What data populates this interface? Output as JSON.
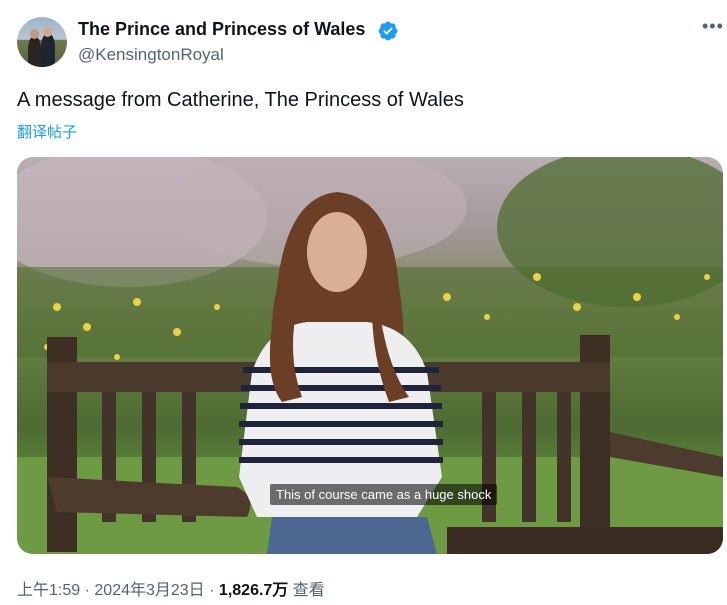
{
  "author": {
    "display_name": "The Prince and Princess of Wales",
    "handle": "@KensingtonRoyal",
    "verified": true,
    "verified_color": "#1d9bf0"
  },
  "tweet": {
    "text": "A message from Catherine, The Princess of Wales",
    "translate_label": "翻译帖子"
  },
  "media": {
    "caption": "This of course came as a huge shock"
  },
  "meta": {
    "time": "上午1:59",
    "separator": "·",
    "date": "2024年3月23日",
    "views_count": "1,826.7万",
    "views_label": "查看"
  },
  "icons": {
    "more": "more-options-icon",
    "verified": "verified-badge-icon"
  },
  "colors": {
    "link": "#1d9bf0",
    "secondary_text": "#536471",
    "primary_text": "#0f1419"
  }
}
